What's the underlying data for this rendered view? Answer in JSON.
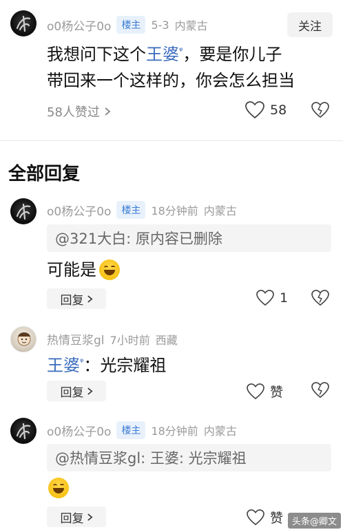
{
  "post": {
    "author": "o0杨公子0o",
    "badge": "楼主",
    "date": "5-3",
    "location": "内蒙古",
    "follow_label": "关注",
    "text_line1_prefix": "我想问下这个",
    "text_link": "王婆",
    "text_line1_suffix": "，要是你儿子",
    "text_line2": "带回来一个这样的，你会怎么担当",
    "likes_summary": "58人赞过",
    "like_count": "58"
  },
  "section": {
    "title": "全部回复"
  },
  "replies": [
    {
      "author": "o0杨公子0o",
      "badge": "楼主",
      "time": "18分钟前",
      "location": "内蒙古",
      "quote": "@321大白: 原内容已删除",
      "text": "可能是",
      "reply_label": "回复",
      "like_count": "1"
    },
    {
      "author": "热情豆浆gl",
      "time": "7小时前",
      "location": "西藏",
      "text_link": "王婆",
      "text_suffix": "：光宗耀祖",
      "reply_label": "回复",
      "like_label": "赞"
    },
    {
      "author": "o0杨公子0o",
      "badge": "楼主",
      "time": "18分钟前",
      "location": "内蒙古",
      "quote": "@热情豆浆gl: 王婆: 光宗耀祖",
      "reply_label": "回复",
      "like_label": "赞"
    }
  ],
  "watermark": "头条@卿文",
  "icons": {
    "heart": "heart-outline-icon",
    "dislike": "broken-heart-icon",
    "chevron": "chevron-right-icon",
    "search_sup": "search-superscript-icon"
  }
}
